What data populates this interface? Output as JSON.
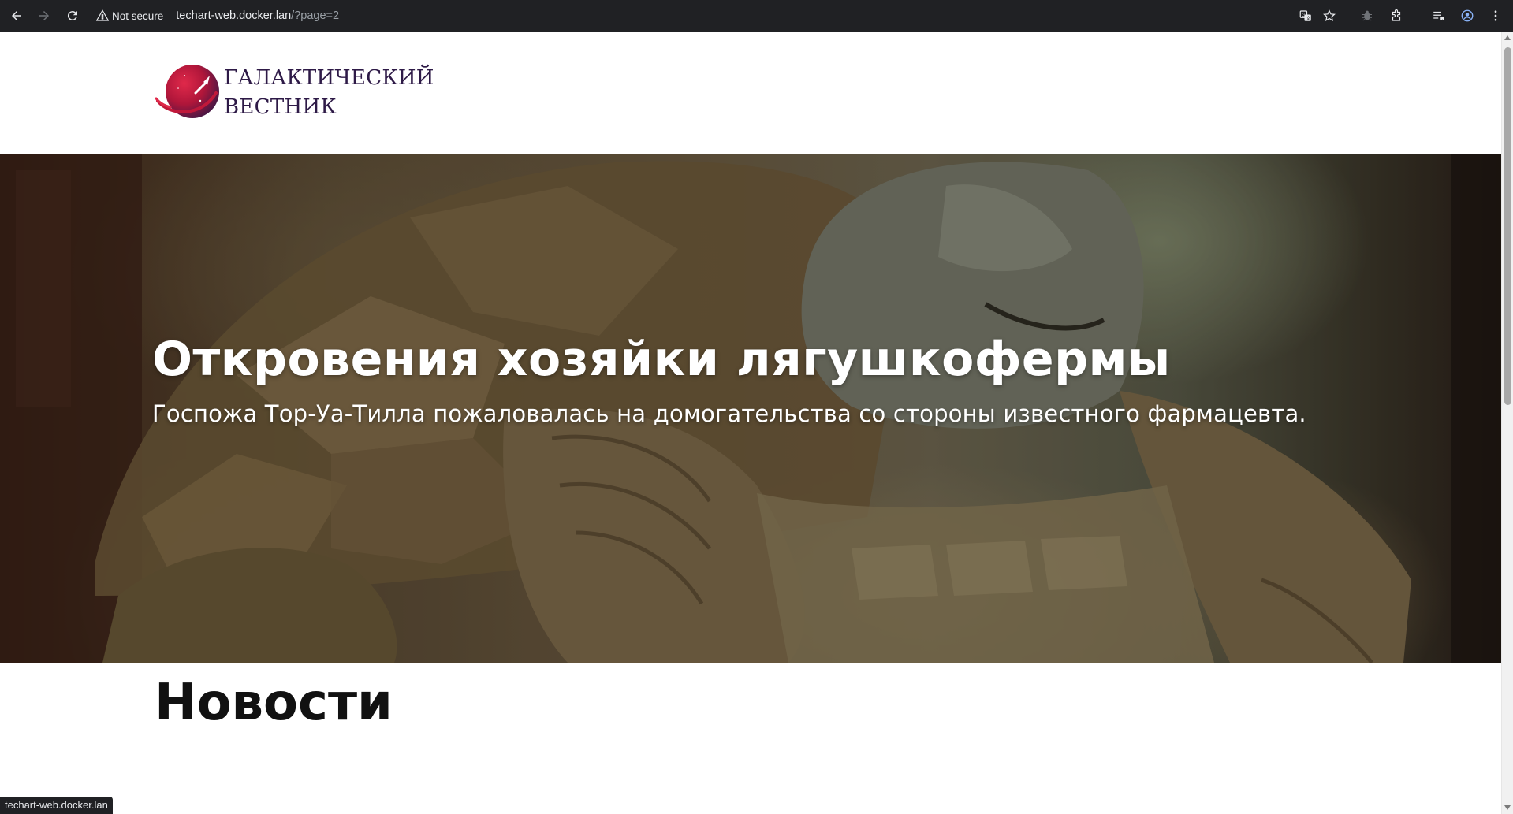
{
  "browser": {
    "security_label": "Not secure",
    "url_host": "techart-web.docker.lan",
    "url_path": "/?page=2",
    "icons": [
      "back-icon",
      "forward-icon",
      "reload-icon",
      "warning-icon",
      "translate-icon",
      "star-icon",
      "extension-bug-icon",
      "extensions-icon",
      "reading-list-icon",
      "profile-icon",
      "more-menu-icon"
    ]
  },
  "header": {
    "logo_line1": "ГАЛАКТИЧЕСКИЙ",
    "logo_line2": "ВЕСТНИК",
    "logo_colors": {
      "planet": "#c0183a",
      "planet_dark": "#4a1744",
      "text": "#2e1a47"
    }
  },
  "hero": {
    "title": "Откровения хозяйки лягушкофермы",
    "subtitle": "Госпожа Тор-Уа-Тилла пожаловалась на домогательства со стороны известного фармацевта."
  },
  "news": {
    "heading": "Новости"
  },
  "status_bar": {
    "link_text": "techart-web.docker.lan"
  }
}
